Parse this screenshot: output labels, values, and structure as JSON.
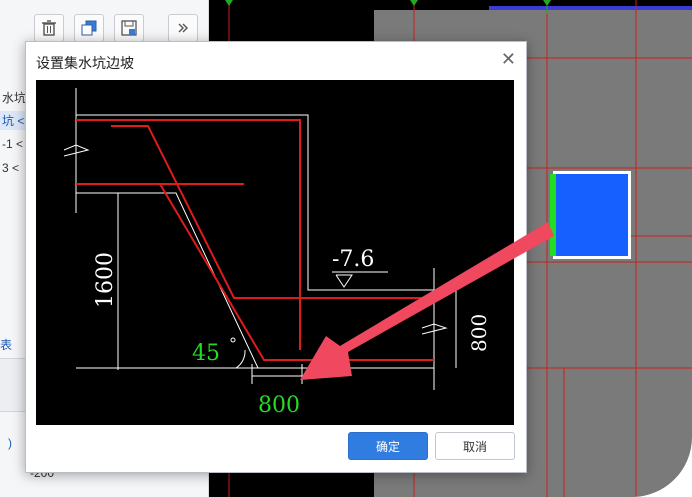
{
  "dialog": {
    "title": "设置集水坑边坡",
    "ok_label": "确定",
    "cancel_label": "取消"
  },
  "drawing": {
    "level_label": "-7.6",
    "depth_label": "1600",
    "right_depth_label": "800",
    "angle_label": "45",
    "width_label": "800"
  },
  "left_panel": {
    "tree_items": [
      "水坑",
      "坑 <",
      "-1 <",
      "3 <"
    ],
    "tab_label": "表",
    "value_text": "-200",
    "fragment_text": ")"
  },
  "colors": {
    "accent_blue": "#2f7de1",
    "grid_red": "#cc1f1f",
    "drawing_green": "#22dd22",
    "pit_blue": "#1560ff",
    "arrow_pink": "#f0485e"
  }
}
